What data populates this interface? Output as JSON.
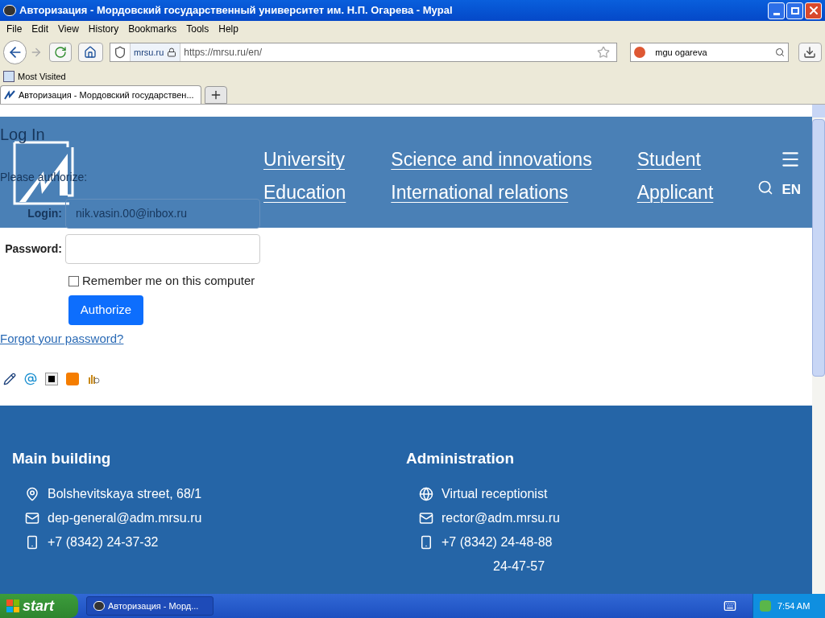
{
  "window": {
    "title": "Авторизация - Мордовский государственный университет им. Н.П. Огарева - Mypal"
  },
  "menu": [
    "File",
    "Edit",
    "View",
    "History",
    "Bookmarks",
    "Tools",
    "Help"
  ],
  "toolbar": {
    "site": "mrsu.ru",
    "url": "https://mrsu.ru/en/",
    "search": "mgu ogareva"
  },
  "bookmarks": [
    "Most Visited"
  ],
  "tabs": [
    {
      "label": "Авторизация - Мордовский государствен...",
      "selected": true
    }
  ],
  "login": {
    "title": "Log In",
    "prompt": "Please authorize:",
    "fields": [
      {
        "label": "Login:",
        "value": "nik.vasin.00@inbox.ru"
      },
      {
        "label": "Password:"
      }
    ],
    "remember": {
      "label": "Remember me on this computer",
      "checked": false
    },
    "button": "Authorize",
    "link": "Forgot your password?"
  },
  "header": {
    "nav": [
      [
        "University",
        "Education"
      ],
      [
        "Science and innovations",
        "International relations"
      ],
      [
        "Student",
        "Applicant"
      ]
    ],
    "lang": {
      "label": "EN",
      "selected": true
    }
  },
  "footer": [
    {
      "title": "Main building",
      "items": [
        {
          "kind": "pin",
          "text": "Bolshevitskaya street, 68/1"
        },
        {
          "kind": "mail",
          "text": "dep-general@adm.mrsu.ru"
        },
        {
          "kind": "phone",
          "text": "+7 (8342) 24-37-32"
        }
      ]
    },
    {
      "title": "Administration",
      "items": [
        {
          "kind": "globe",
          "text": "Virtual receptionist"
        },
        {
          "kind": "mail",
          "text": "rector@adm.mrsu.ru"
        },
        {
          "kind": "phone",
          "text": "+7 (8342) 24-48-88"
        },
        {
          "kind": "none",
          "text": "24-47-57"
        }
      ]
    }
  ],
  "taskbar": {
    "start": "start",
    "task": "Авторизация - Морд...",
    "time": "7:54 AM"
  }
}
